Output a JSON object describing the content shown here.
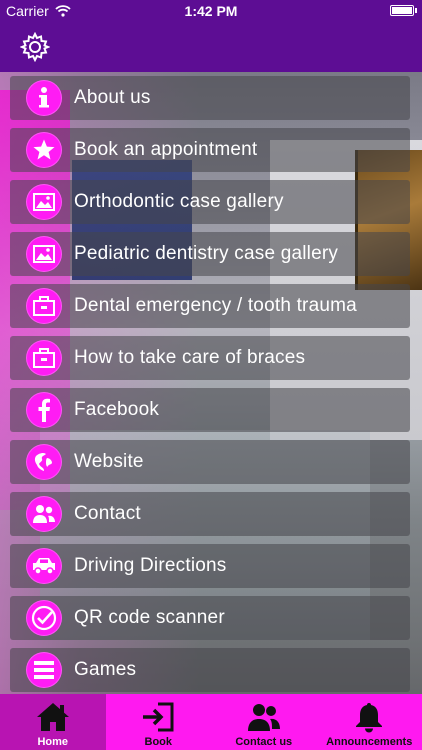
{
  "status_bar": {
    "carrier": "Carrier",
    "time": "1:42 PM"
  },
  "nav": {
    "settings_icon": "gear-icon"
  },
  "menu": {
    "items": [
      {
        "label": "About us",
        "icon": "info-icon"
      },
      {
        "label": "Book an appointment",
        "icon": "star-icon"
      },
      {
        "label": "Orthodontic case gallery",
        "icon": "gallery-icon"
      },
      {
        "label": "Pediatric dentistry case gallery",
        "icon": "gallery-icon"
      },
      {
        "label": "Dental emergency / tooth trauma",
        "icon": "briefcase-icon"
      },
      {
        "label": "How to take care of braces",
        "icon": "briefcase-icon"
      },
      {
        "label": "Facebook",
        "icon": "facebook-icon"
      },
      {
        "label": "Website",
        "icon": "globe-icon"
      },
      {
        "label": "Contact",
        "icon": "contacts-icon"
      },
      {
        "label": "Driving Directions",
        "icon": "car-icon"
      },
      {
        "label": "QR code scanner",
        "icon": "check-circle-icon"
      },
      {
        "label": "Games",
        "icon": "games-icon"
      }
    ]
  },
  "tabs": [
    {
      "label": "Home",
      "icon": "home-icon",
      "active": true
    },
    {
      "label": "Book",
      "icon": "sign-in-icon",
      "active": false
    },
    {
      "label": "Contact us",
      "icon": "people-icon",
      "active": false
    },
    {
      "label": "Announcements",
      "icon": "bell-icon",
      "active": false
    }
  ],
  "colors": {
    "header_purple": "#5d0d94",
    "accent_magenta": "#ff1cf4",
    "tab_active": "#b814b2"
  }
}
